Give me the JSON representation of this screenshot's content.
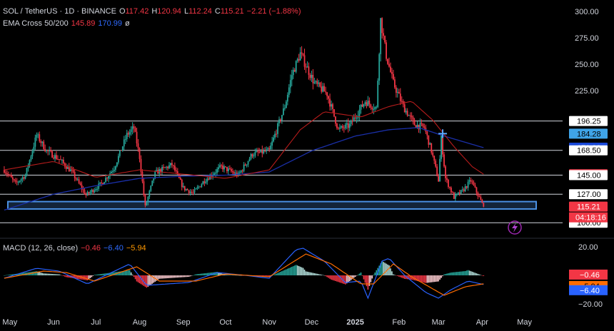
{
  "header": {
    "symbol": "SOL / TetherUS · 1D · BINANCE",
    "o_label": "O",
    "o_value": "117.42",
    "h_label": "H",
    "h_value": "120.94",
    "l_label": "L",
    "l_value": "112.24",
    "c_label": "C",
    "c_value": "115.21",
    "change": "−2.21 (−1.88%)",
    "ema_label": "EMA Cross 50/200",
    "ema50": "145.89",
    "ema200": "170.99",
    "ema_icon": "ø"
  },
  "macd_header": {
    "label": "MACD (12, 26, close)",
    "hist": "−0.46",
    "macd": "−6.40",
    "signal": "−5.94"
  },
  "price_axis": {
    "ticks": [
      "300.00",
      "275.00",
      "250.00",
      "225.00",
      "196.25",
      "168.50",
      "145.00",
      "127.00",
      "100.00"
    ],
    "badges": [
      {
        "value": "196.25",
        "color": "#ffffff",
        "text_color": "#000000"
      },
      {
        "value": "184.28",
        "color": "#3fa4e8",
        "text_color": "#000000"
      },
      {
        "value": "170.99",
        "color": "#1848d8",
        "text_color": "#ffffff"
      },
      {
        "value": "168.50",
        "color": "#ffffff",
        "text_color": "#000000"
      },
      {
        "value": "145.89",
        "color": "#f23645",
        "text_color": "#000000"
      },
      {
        "value": "145.00",
        "color": "#ffffff",
        "text_color": "#000000"
      },
      {
        "value": "127.00",
        "color": "#ffffff",
        "text_color": "#000000"
      },
      {
        "value": "115.21",
        "color": "#f23645",
        "text_color": "#ffffff"
      },
      {
        "value": "100.00",
        "color": "#ffffff",
        "text_color": "#000000"
      }
    ],
    "countdown": "04:18:16"
  },
  "macd_axis": {
    "ticks": [
      "20.00",
      "−20.00"
    ],
    "badges": [
      {
        "value": "−0.46",
        "color": "#f23645",
        "text_color": "#ffffff"
      },
      {
        "value": "−5.94",
        "color": "#ff6d00",
        "text_color": "#000000"
      },
      {
        "value": "−6.40",
        "color": "#2962ff",
        "text_color": "#ffffff"
      }
    ]
  },
  "time_axis": [
    "May",
    "Jun",
    "Jul",
    "Aug",
    "Sep",
    "Oct",
    "Nov",
    "Dec",
    "2025",
    "Feb",
    "Mar",
    "Apr",
    "May"
  ],
  "colors": {
    "up": "#26a69a",
    "down": "#f23645",
    "ema50": "#b71c1c",
    "ema200": "#1a2fa8",
    "macd": "#2962ff",
    "signal": "#ff6d00",
    "hline": "#d1d4dc",
    "box": "#4a90e2"
  },
  "chart_data": {
    "type": "candlestick",
    "title": "SOL / TetherUS · 1D · BINANCE",
    "ylim": [
      88,
      308
    ],
    "last_close": 115.21,
    "x_range": [
      "2024-05-01",
      "2025-04-02"
    ],
    "horizontal_levels": [
      196.25,
      168.5,
      145.0,
      127.0,
      100.0
    ],
    "support_zone": [
      113,
      120
    ],
    "price_path": [
      [
        "2024-04-27",
        150
      ],
      [
        "2024-05-05",
        137
      ],
      [
        "2024-05-12",
        145
      ],
      [
        "2024-05-20",
        183
      ],
      [
        "2024-05-27",
        168
      ],
      [
        "2024-06-05",
        160
      ],
      [
        "2024-06-14",
        148
      ],
      [
        "2024-06-24",
        126
      ],
      [
        "2024-07-05",
        137
      ],
      [
        "2024-07-14",
        152
      ],
      [
        "2024-07-23",
        183
      ],
      [
        "2024-07-28",
        190
      ],
      [
        "2024-08-01",
        162
      ],
      [
        "2024-08-05",
        115
      ],
      [
        "2024-08-12",
        147
      ],
      [
        "2024-08-24",
        155
      ],
      [
        "2024-09-01",
        133
      ],
      [
        "2024-09-08",
        128
      ],
      [
        "2024-09-16",
        140
      ],
      [
        "2024-09-28",
        153
      ],
      [
        "2024-10-10",
        145
      ],
      [
        "2024-10-20",
        165
      ],
      [
        "2024-11-01",
        168
      ],
      [
        "2024-11-12",
        210
      ],
      [
        "2024-11-17",
        240
      ],
      [
        "2024-11-23",
        260
      ],
      [
        "2024-12-03",
        232
      ],
      [
        "2024-12-12",
        222
      ],
      [
        "2024-12-20",
        188
      ],
      [
        "2024-12-28",
        192
      ],
      [
        "2025-01-08",
        215
      ],
      [
        "2025-01-16",
        208
      ],
      [
        "2025-01-19",
        292
      ],
      [
        "2025-01-23",
        258
      ],
      [
        "2025-01-28",
        232
      ],
      [
        "2025-02-04",
        210
      ],
      [
        "2025-02-12",
        193
      ],
      [
        "2025-02-19",
        190
      ],
      [
        "2025-02-24",
        168
      ],
      [
        "2025-03-01",
        140
      ],
      [
        "2025-03-03",
        180
      ],
      [
        "2025-03-06",
        142
      ],
      [
        "2025-03-12",
        124
      ],
      [
        "2025-03-18",
        130
      ],
      [
        "2025-03-24",
        140
      ],
      [
        "2025-03-28",
        129
      ],
      [
        "2025-04-02",
        115.21
      ]
    ],
    "ema50_path": [
      [
        "2024-04-27",
        150
      ],
      [
        "2024-06-01",
        158
      ],
      [
        "2024-07-01",
        143
      ],
      [
        "2024-08-01",
        150
      ],
      [
        "2024-09-01",
        146
      ],
      [
        "2024-10-01",
        142
      ],
      [
        "2024-11-01",
        150
      ],
      [
        "2024-11-23",
        188
      ],
      [
        "2024-12-10",
        205
      ],
      [
        "2025-01-05",
        200
      ],
      [
        "2025-01-25",
        210
      ],
      [
        "2025-02-10",
        215
      ],
      [
        "2025-02-25",
        197
      ],
      [
        "2025-03-12",
        172
      ],
      [
        "2025-03-25",
        153
      ],
      [
        "2025-04-02",
        145.89
      ]
    ],
    "ema200_path": [
      [
        "2024-04-27",
        112
      ],
      [
        "2024-06-01",
        127
      ],
      [
        "2024-07-01",
        135
      ],
      [
        "2024-08-01",
        142
      ],
      [
        "2024-09-01",
        144
      ],
      [
        "2024-10-01",
        145
      ],
      [
        "2024-11-01",
        148
      ],
      [
        "2024-12-01",
        168
      ],
      [
        "2025-01-01",
        182
      ],
      [
        "2025-01-25",
        188
      ],
      [
        "2025-02-15",
        190
      ],
      [
        "2025-03-05",
        182
      ],
      [
        "2025-04-02",
        170.99
      ]
    ],
    "macd_path": [
      [
        "2024-04-27",
        -2
      ],
      [
        "2024-05-20",
        5
      ],
      [
        "2024-06-05",
        3
      ],
      [
        "2024-06-25",
        -6
      ],
      [
        "2024-07-25",
        8
      ],
      [
        "2024-08-06",
        -7
      ],
      [
        "2024-09-05",
        -5
      ],
      [
        "2024-09-25",
        2
      ],
      [
        "2024-10-15",
        0
      ],
      [
        "2024-11-01",
        -2
      ],
      [
        "2024-11-20",
        18
      ],
      [
        "2024-11-25",
        19
      ],
      [
        "2024-12-10",
        10
      ],
      [
        "2024-12-25",
        -5
      ],
      [
        "2025-01-05",
        -4
      ],
      [
        "2025-01-10",
        -16
      ],
      [
        "2025-01-20",
        10
      ],
      [
        "2025-01-25",
        12
      ],
      [
        "2025-02-05",
        0
      ],
      [
        "2025-02-20",
        -12
      ],
      [
        "2025-03-01",
        -16
      ],
      [
        "2025-03-10",
        -10
      ],
      [
        "2025-03-22",
        -4
      ],
      [
        "2025-04-02",
        -6.4
      ]
    ],
    "signal_path": [
      [
        "2024-04-27",
        -2
      ],
      [
        "2024-05-25",
        3
      ],
      [
        "2024-06-10",
        2
      ],
      [
        "2024-06-30",
        -4
      ],
      [
        "2024-07-30",
        6
      ],
      [
        "2024-08-15",
        -4
      ],
      [
        "2024-09-10",
        -4
      ],
      [
        "2024-10-01",
        1
      ],
      [
        "2024-11-01",
        -1
      ],
      [
        "2024-11-27",
        15
      ],
      [
        "2024-12-15",
        8
      ],
      [
        "2025-01-05",
        -6
      ],
      [
        "2025-01-14",
        -6
      ],
      [
        "2025-01-28",
        8
      ],
      [
        "2025-02-10",
        -1
      ],
      [
        "2025-03-05",
        -14
      ],
      [
        "2025-03-20",
        -8
      ],
      [
        "2025-04-02",
        -5.94
      ]
    ],
    "macd_ylim": [
      -25,
      24
    ]
  }
}
